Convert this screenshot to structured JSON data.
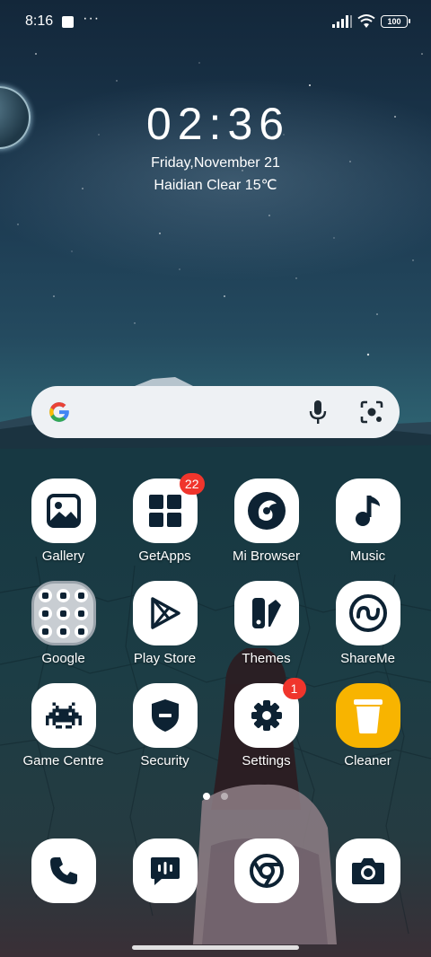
{
  "status_bar": {
    "time": "8:16",
    "overflow": "···",
    "battery": "100"
  },
  "clock": {
    "time": "02:36",
    "date": "Friday,November 21",
    "weather": "Haidian Clear 15℃"
  },
  "search": {
    "logo": "google-g-icon",
    "mic": "microphone-icon",
    "lens": "camera-lens-icon"
  },
  "apps": [
    {
      "label": "Gallery",
      "icon": "gallery-icon"
    },
    {
      "label": "GetApps",
      "icon": "getapps-icon",
      "badge": "22"
    },
    {
      "label": "Mi Browser",
      "icon": "mi-browser-icon"
    },
    {
      "label": "Music",
      "icon": "music-note-icon"
    },
    {
      "label": "Google",
      "icon": "google-folder-icon"
    },
    {
      "label": "Play Store",
      "icon": "play-store-icon"
    },
    {
      "label": "Themes",
      "icon": "themes-icon"
    },
    {
      "label": "ShareMe",
      "icon": "shareme-icon"
    },
    {
      "label": "Game Centre",
      "icon": "game-invader-icon"
    },
    {
      "label": "Security",
      "icon": "security-shield-icon"
    },
    {
      "label": "Settings",
      "icon": "settings-gear-icon",
      "badge": "1"
    },
    {
      "label": "Cleaner",
      "icon": "cleaner-trash-icon"
    }
  ],
  "dock": [
    {
      "icon": "phone-icon"
    },
    {
      "icon": "messages-icon"
    },
    {
      "icon": "chrome-icon"
    },
    {
      "icon": "camera-icon"
    }
  ],
  "page_indicator": {
    "pages": 2,
    "active": 1
  },
  "colors": {
    "icon_fg": "#0d2233",
    "badge": "#f0352c",
    "cleaner": "#f8b400"
  }
}
